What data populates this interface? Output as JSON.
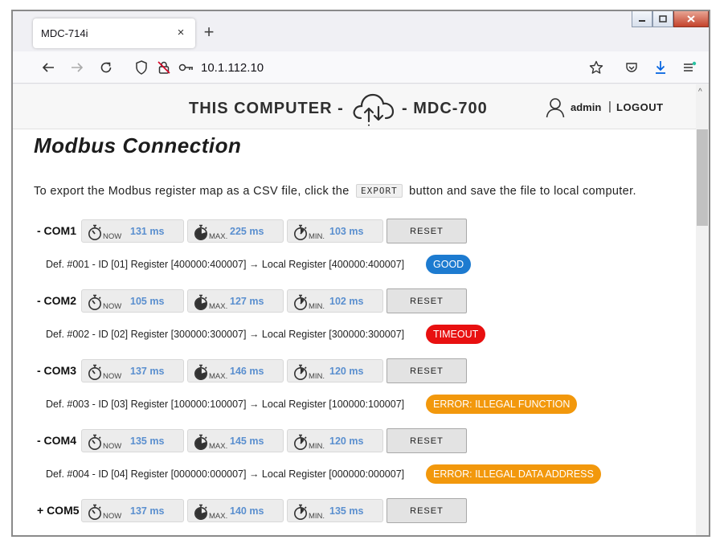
{
  "browser": {
    "tab_title": "MDC-714i",
    "tab_close": "×",
    "new_tab": "+",
    "url": "10.1.112.10"
  },
  "header": {
    "brand_left": "THIS COMPUTER -",
    "brand_right": "- MDC-700",
    "user": "admin",
    "separator": "|",
    "logout": "LOGOUT"
  },
  "page": {
    "title": "Modbus Connection",
    "intro_before": "To export the Modbus register map as a CSV file, click the",
    "export_label": "EXPORT",
    "intro_after": "button and save the file to local computer."
  },
  "timer_labels": {
    "now": "NOW",
    "max": "MAX.",
    "min": "MIN."
  },
  "reset_label": "RESET",
  "colors": {
    "good": "#1d7bd0",
    "timeout": "#e81010",
    "error": "#f2980c",
    "timer_value": "#5a8fcf"
  },
  "ports": [
    {
      "name": "- COM1",
      "now": "131 ms",
      "max": "225 ms",
      "min": "103 ms",
      "definition": "Def. #001 - ID [01] Register [400000:400007]  → Local Register [400000:400007]",
      "status": "GOOD",
      "status_type": "good"
    },
    {
      "name": "- COM2",
      "now": "105 ms",
      "max": "127 ms",
      "min": "102 ms",
      "definition": "Def. #002 - ID [02] Register [300000:300007]  → Local Register [300000:300007]",
      "status": "TIMEOUT",
      "status_type": "timeout"
    },
    {
      "name": "- COM3",
      "now": "137 ms",
      "max": "146 ms",
      "min": "120 ms",
      "definition": "Def. #003 - ID [03] Register [100000:100007]  → Local Register [100000:100007]",
      "status": "ERROR: ILLEGAL FUNCTION",
      "status_type": "error"
    },
    {
      "name": "- COM4",
      "now": "135 ms",
      "max": "145 ms",
      "min": "120 ms",
      "definition": "Def. #004 - ID [04] Register [000000:000007]  → Local Register [000000:000007]",
      "status": "ERROR: ILLEGAL DATA ADDRESS",
      "status_type": "error"
    },
    {
      "name": "+ COM5",
      "now": "137 ms",
      "max": "140 ms",
      "min": "135 ms"
    }
  ]
}
